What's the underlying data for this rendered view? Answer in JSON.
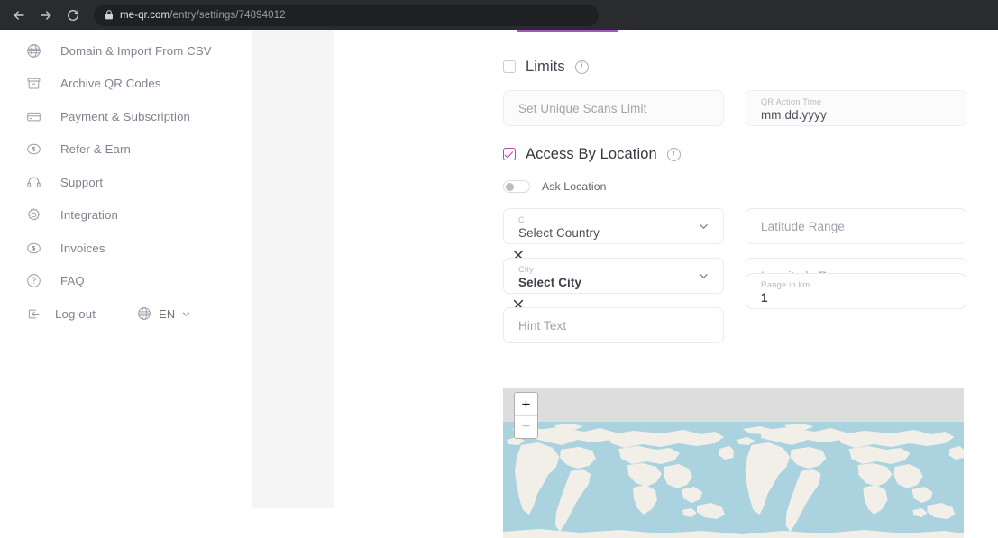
{
  "browser": {
    "back_icon": "arrow-left-icon",
    "forward_icon": "arrow-right-icon",
    "reload_icon": "reload-icon",
    "lock_icon": "lock-icon",
    "url_host": "me-qr.com",
    "url_path": "/entry/settings/74894012"
  },
  "sidebar": {
    "items": [
      {
        "icon": "globe-icon",
        "label": "Domain & Import From CSV"
      },
      {
        "icon": "archive-icon",
        "label": "Archive QR Codes"
      },
      {
        "icon": "credit-card-icon",
        "label": "Payment & Subscription"
      },
      {
        "icon": "dollar-circle-icon",
        "label": "Refer & Earn"
      },
      {
        "icon": "headset-icon",
        "label": "Support"
      },
      {
        "icon": "gear-icon",
        "label": "Integration"
      },
      {
        "icon": "invoice-icon",
        "label": "Invoices"
      },
      {
        "icon": "question-circle-icon",
        "label": "FAQ"
      }
    ],
    "logout": {
      "icon": "logout-icon",
      "label": "Log out"
    },
    "language": {
      "icon": "globe-icon",
      "label": "EN",
      "chevron": "chevron-down-icon"
    }
  },
  "main": {
    "accent_color": "#a855c4",
    "checkbox_accent": "#c13bbd",
    "limits": {
      "title": "Limits",
      "checked": false,
      "info_icon": "info-icon",
      "scans_limit_placeholder": "Set Unique Scans Limit",
      "action_time_label": "QR Action Time",
      "action_time_value": "mm.dd.yyyy"
    },
    "access_by_location": {
      "title": "Access By Location",
      "checked": true,
      "info_icon": "info-icon",
      "ask_location_label": "Ask Location",
      "ask_location_on": false,
      "country_label": "C",
      "country_value": "Select Country",
      "country_chevron": "chevron-down-icon",
      "country_clear_icon": "close-icon",
      "city_label": "City",
      "city_value": "Select City",
      "city_chevron": "chevron-down-icon",
      "city_clear_icon": "close-icon",
      "hint_text_placeholder": "Hint Text",
      "latitude_placeholder": "Latitude Range",
      "longitude_placeholder": "Longitude Range",
      "range_km_label": "Range in km",
      "range_km_value": "1"
    },
    "map": {
      "zoom_in_label": "+",
      "zoom_out_label": "−",
      "ocean_color": "#aad3df",
      "land_color": "#f2efe9"
    }
  }
}
